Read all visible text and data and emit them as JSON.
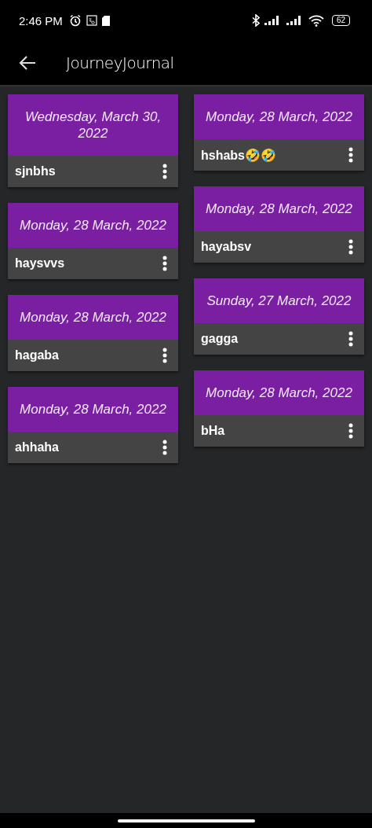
{
  "status_bar": {
    "time": "2:46 PM",
    "battery": "62"
  },
  "app_bar": {
    "title": "JourneyJournal"
  },
  "columns": [
    [
      {
        "date": "Wednesday, March 30, 2022",
        "title": "sjnbhs"
      },
      {
        "date": "Monday, 28 March, 2022",
        "title": "haysvvs"
      },
      {
        "date": "Monday, 28 March, 2022",
        "title": "hagaba"
      },
      {
        "date": "Monday, 28 March, 2022",
        "title": "ahhaha"
      }
    ],
    [
      {
        "date": "Monday, 28 March, 2022",
        "title": "hshabs🤣🤣"
      },
      {
        "date": "Monday, 28 March, 2022",
        "title": "hayabsv"
      },
      {
        "date": "Sunday, 27 March, 2022",
        "title": "gagga"
      },
      {
        "date": "Monday, 28 March, 2022",
        "title": "bHa"
      }
    ]
  ]
}
